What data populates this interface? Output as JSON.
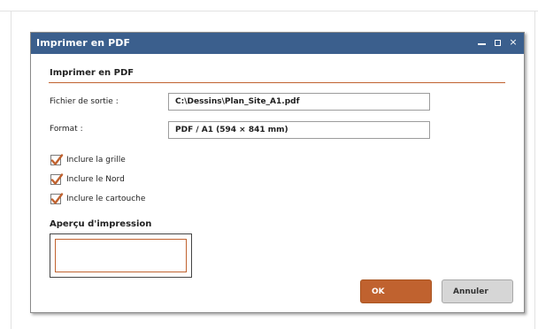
{
  "dialog": {
    "title": "Imprimer en PDF",
    "controls": {
      "minimize": "—",
      "maximize": "□",
      "close": "×"
    }
  },
  "section": {
    "title": "Imprimer en PDF"
  },
  "fields": {
    "output_label": "Fichier de sortie :",
    "output_value": "C:\\Dessins\\Plan_Site_A1.pdf",
    "format_label": "Format :",
    "format_value": "PDF / A1 (594 × 841 mm)"
  },
  "options": [
    {
      "label": "Inclure la grille",
      "checked": true
    },
    {
      "label": "Inclure le Nord",
      "checked": true
    },
    {
      "label": "Inclure le cartouche",
      "checked": true
    }
  ],
  "preview": {
    "title": "Aperçu d'impression"
  },
  "buttons": {
    "ok": "OK",
    "cancel": "Annuler"
  },
  "colors": {
    "titlebar": "#3b5f8d",
    "accent": "#c0622f",
    "cancel_bg": "#d6d6d6"
  }
}
